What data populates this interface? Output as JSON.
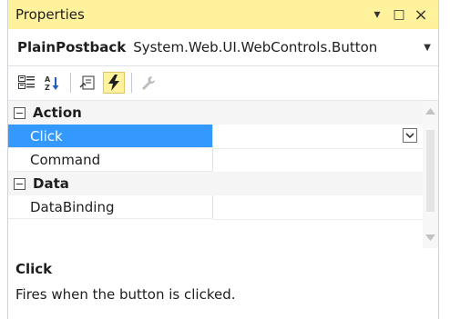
{
  "window": {
    "title": "Properties",
    "buttons": {
      "pin": "▾",
      "restore": "□",
      "close": "×"
    }
  },
  "object_selector": {
    "name": "PlainPostback",
    "type": "System.Web.UI.WebControls.Button"
  },
  "toolbar": {
    "buttons": [
      {
        "icon": "categorized-icon",
        "active": false
      },
      {
        "icon": "alphabetical-icon",
        "active": false
      },
      {
        "icon": "properties-icon",
        "active": false
      },
      {
        "icon": "events-icon",
        "active": true
      },
      {
        "icon": "property-pages-icon",
        "active": false
      }
    ]
  },
  "grid": {
    "categories": [
      {
        "label": "Action",
        "toggle": "−",
        "rows": [
          {
            "name": "Click",
            "value": "",
            "selected": true
          },
          {
            "name": "Command",
            "value": ""
          }
        ]
      },
      {
        "label": "Data",
        "toggle": "−",
        "rows": [
          {
            "name": "DataBinding",
            "value": ""
          }
        ]
      }
    ]
  },
  "description": {
    "title": "Click",
    "text": "Fires when the button is clicked."
  },
  "colors": {
    "title_bar": "#fff29d",
    "selection": "#3399ff",
    "category_bg": "#f5f5f5"
  }
}
